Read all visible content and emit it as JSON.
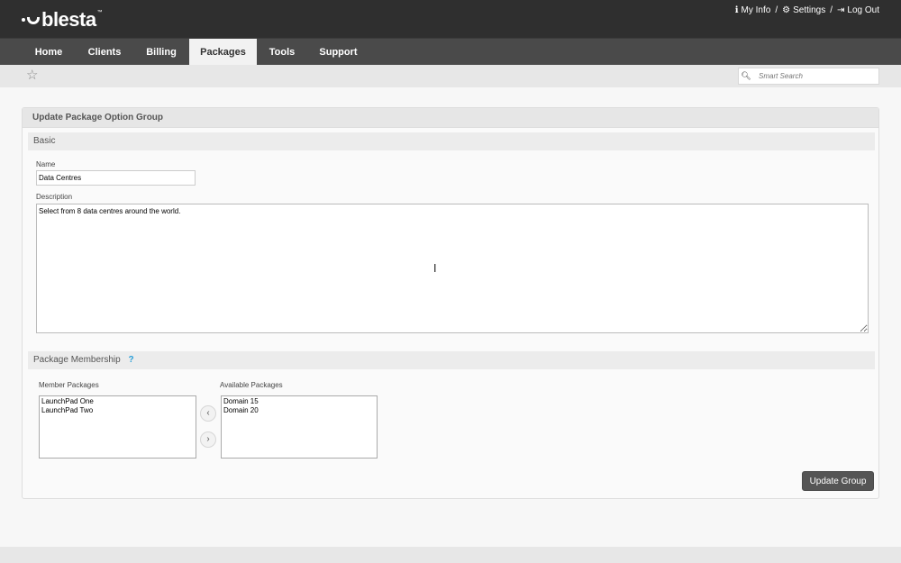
{
  "header": {
    "logo_text": "blesta",
    "logo_tm": "™",
    "links": [
      {
        "label": "My Info",
        "icon": "info-icon"
      },
      {
        "label": "Settings",
        "icon": "gear-icon"
      },
      {
        "label": "Log Out",
        "icon": "logout-icon"
      }
    ],
    "separator": "/"
  },
  "nav": {
    "items": [
      {
        "label": "Home",
        "active": false
      },
      {
        "label": "Clients",
        "active": false
      },
      {
        "label": "Billing",
        "active": false
      },
      {
        "label": "Packages",
        "active": true
      },
      {
        "label": "Tools",
        "active": false
      },
      {
        "label": "Support",
        "active": false
      }
    ]
  },
  "subbar": {
    "star_icon": "star-icon",
    "search_placeholder": "Smart Search"
  },
  "panel": {
    "title": "Update Package Option Group",
    "basic": {
      "heading": "Basic",
      "name_label": "Name",
      "name_value": "Data Centres",
      "description_label": "Description",
      "description_value": "Select from 8 data centres around the world."
    },
    "membership": {
      "heading": "Package Membership",
      "help": "?",
      "member_label": "Member Packages",
      "member_packages": [
        "LaunchPad One",
        "LaunchPad Two"
      ],
      "available_label": "Available Packages",
      "available_packages": [
        "Domain 15",
        "Domain 20"
      ],
      "move_left": "‹",
      "move_right": "›"
    },
    "submit_label": "Update Group"
  }
}
